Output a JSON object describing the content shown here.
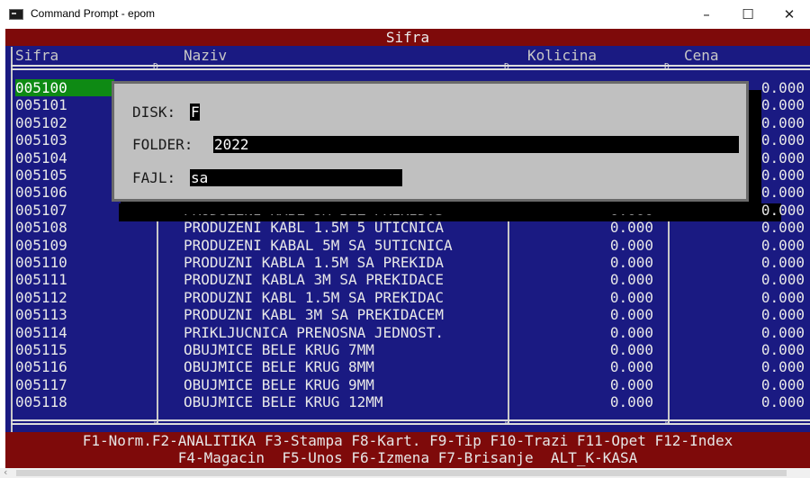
{
  "window": {
    "title": "Command Prompt - epom",
    "minimize": "–",
    "maximize": "☐",
    "close": "✕"
  },
  "screen": {
    "header_title": "Sifra",
    "columns": {
      "code": "Sifra",
      "name": "Naziv",
      "qty": "Kolicina",
      "price": "Cena"
    },
    "separator_glyph": "Ð",
    "bottom_glyph": "¤"
  },
  "rows": [
    {
      "code": "005100",
      "name": "",
      "qty": "",
      "price": "0.000"
    },
    {
      "code": "005101",
      "name": "",
      "qty": "",
      "price": "0.000"
    },
    {
      "code": "005102",
      "name": "",
      "qty": "",
      "price": "0.000"
    },
    {
      "code": "005103",
      "name": "",
      "qty": "",
      "price": "0.000"
    },
    {
      "code": "005104",
      "name": "",
      "qty": "",
      "price": "0.000"
    },
    {
      "code": "005105",
      "name": "",
      "qty": "",
      "price": "0.000"
    },
    {
      "code": "005106",
      "name": "",
      "qty": "",
      "price": "0.000"
    },
    {
      "code": "005107",
      "name": "PRODUZENI KABL 5M BEZ PREKID.3",
      "qty": "0.000",
      "price": "0.000"
    },
    {
      "code": "005108",
      "name": "PRODUZENI KABL 1.5M 5 UTICNICA",
      "qty": "0.000",
      "price": "0.000"
    },
    {
      "code": "005109",
      "name": "PRODUZENI KABAL 5M SA 5UTICNICA",
      "qty": "0.000",
      "price": "0.000"
    },
    {
      "code": "005110",
      "name": "PRODUZNI KABLA 1.5M SA PREKIDA",
      "qty": "0.000",
      "price": "0.000"
    },
    {
      "code": "005111",
      "name": "PRODUZNI KABLA 3M SA PREKIDACE",
      "qty": "0.000",
      "price": "0.000"
    },
    {
      "code": "005112",
      "name": "PRODUZNI KABL 1.5M SA PREKIDAC",
      "qty": "0.000",
      "price": "0.000"
    },
    {
      "code": "005113",
      "name": "PRODUZNI KABL 3M SA PREKIDACEM",
      "qty": "0.000",
      "price": "0.000"
    },
    {
      "code": "005114",
      "name": "PRIKLJUCNICA PRENOSNA JEDNOST.",
      "qty": "0.000",
      "price": "0.000"
    },
    {
      "code": "005115",
      "name": "OBUJMICE BELE KRUG 7MM",
      "qty": "0.000",
      "price": "0.000"
    },
    {
      "code": "005116",
      "name": "OBUJMICE BELE KRUG 8MM",
      "qty": "0.000",
      "price": "0.000"
    },
    {
      "code": "005117",
      "name": "OBUJMICE BELE KRUG 9MM",
      "qty": "0.000",
      "price": "0.000"
    },
    {
      "code": "005118",
      "name": "OBUJMICE BELE KRUG 12MM",
      "qty": "0.000",
      "price": "0.000"
    }
  ],
  "dialog": {
    "disk_label": "DISK:",
    "disk_value": "F",
    "folder_label": "FOLDER:",
    "folder_value": "2022",
    "file_label": "FAJL:",
    "file_value": "sa"
  },
  "footer": {
    "line1": "F1-Norm.F2-ANALITIKA F3-Stampa F8-Kart. F9-Tip F10-Trazi F11-Opet F12-Index",
    "line2": "F4-Magacin  F5-Unos F6-Izmena F7-Brisanje  ALT_K-KASA"
  },
  "colors": {
    "console_bg": "#1a1a82",
    "header_bg": "#7e0a0a",
    "selected_code_bg": "#0e8a14",
    "dialog_bg": "#c0c0c0"
  }
}
